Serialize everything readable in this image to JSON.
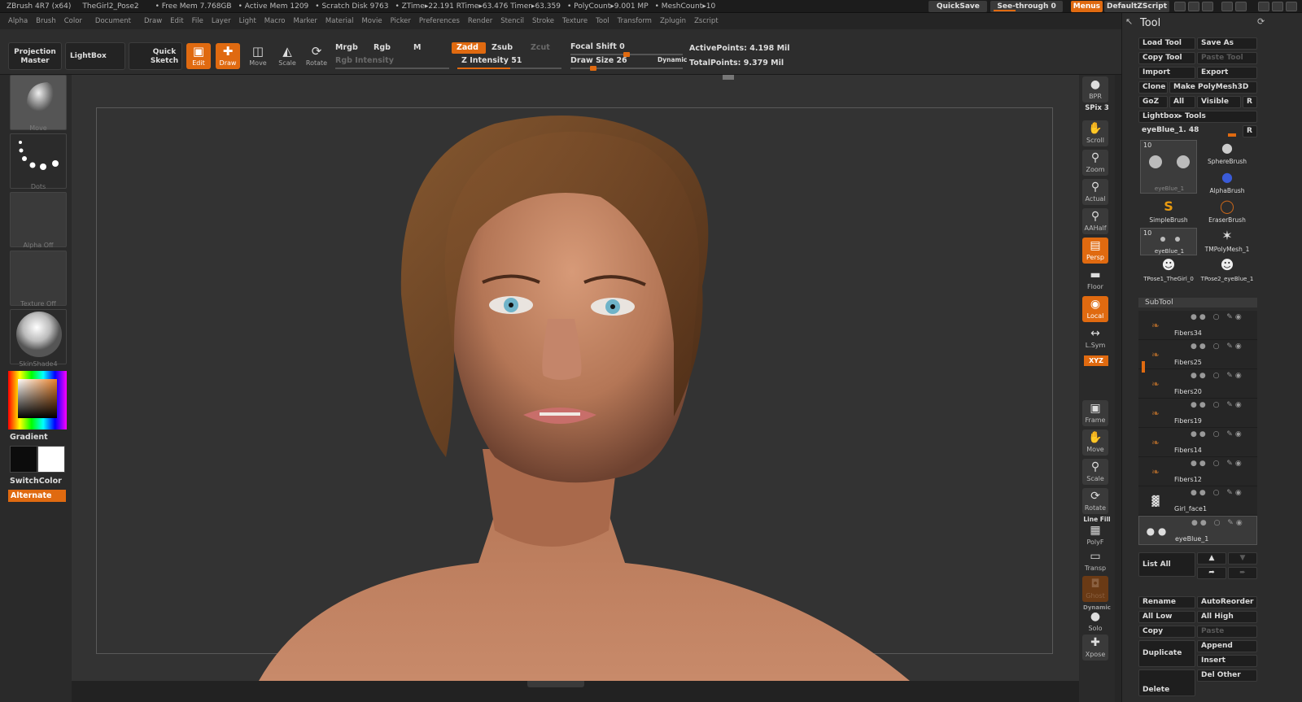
{
  "titlebar": {
    "app": "ZBrush 4R7 (x64)",
    "doc": "TheGirl2_Pose2",
    "free_mem": "• Free Mem 7.768GB",
    "active_mem": "• Active Mem 1209",
    "scratch": "• Scratch Disk 9763",
    "ztime": "• ZTime▸22.191 RTime▸63.476 Timer▸63.359",
    "polycount": "• PolyCount▸9.001 MP",
    "meshcount": "• MeshCount▸10",
    "quicksave": "QuickSave",
    "seethrough": "See-through  0",
    "menus": "Menus",
    "defaultzscript": "DefaultZScript"
  },
  "menubar": [
    "Alpha",
    "Brush",
    "Color",
    "Document",
    "Draw",
    "Edit",
    "File",
    "Layer",
    "Light",
    "Macro",
    "Marker",
    "Material",
    "Movie",
    "Picker",
    "Preferences",
    "Render",
    "Stencil",
    "Stroke",
    "Texture",
    "Tool",
    "Transform",
    "Zplugin",
    "Zscript"
  ],
  "toolbar": {
    "projection_master": "Projection Master",
    "lightbox": "LightBox",
    "quick_sketch": "Quick Sketch",
    "edit": "Edit",
    "draw": "Draw",
    "move": "Move",
    "scale": "Scale",
    "rotate": "Rotate",
    "mrgb": "Mrgb",
    "rgb": "Rgb",
    "m": "M",
    "rgb_intensity": "Rgb Intensity",
    "zadd": "Zadd",
    "zsub": "Zsub",
    "zcut": "Zcut",
    "z_intensity": "Z Intensity 51",
    "focal_shift": "Focal Shift 0",
    "draw_size": "Draw Size 26",
    "dynamic": "Dynamic",
    "active_points": "ActivePoints: 4.198  Mil",
    "total_points": "TotalPoints: 9.379  Mil",
    "z_intensity_level": 0.51,
    "focal_shift_level": 0.5,
    "draw_size_level": 0.2
  },
  "leftpanel": {
    "brush": "Move",
    "stroke": "Dots",
    "alpha": "Alpha  Off",
    "texture": "Texture  Off",
    "material": "SkinShade4",
    "gradient": "Gradient",
    "switchcolor": "SwitchColor",
    "alternate": "Alternate"
  },
  "rightshelf": {
    "bpr": "BPR",
    "spix": "SPix 3",
    "scroll": "Scroll",
    "zoom": "Zoom",
    "actual": "Actual",
    "aahalf": "AAHalf",
    "persp": "Persp",
    "floor": "Floor",
    "local": "Local",
    "lsym": "L.Sym",
    "xyz": "XYZ",
    "frame": "Frame",
    "move": "Move",
    "scale": "Scale",
    "rotate": "Rotate",
    "linefill": "Line Fill",
    "polyf": "PolyF",
    "transp": "Transp",
    "ghost": "Ghost",
    "dynamic": "Dynamic",
    "solo": "Solo",
    "xpose": "Xpose"
  },
  "toolpanel": {
    "title": "Tool",
    "load_tool": "Load Tool",
    "save_as": "Save As",
    "copy_tool": "Copy Tool",
    "paste_tool": "Paste Tool",
    "import": "Import",
    "export": "Export",
    "clone": "Clone",
    "make_polymesh": "Make PolyMesh3D",
    "goz": "GoZ",
    "all": "All",
    "visible": "Visible",
    "r": "R",
    "lightbox_tools": "Lightbox▸ Tools",
    "current_tool": "eyeBlue_1. 48",
    "current_tool_r": "R",
    "thumbs": [
      {
        "label": "eyeBlue_1",
        "count": "10"
      },
      {
        "label": "SphereBrush"
      },
      {
        "label": "AlphaBrush"
      },
      {
        "label": "SimpleBrush"
      },
      {
        "label": "EraserBrush"
      },
      {
        "label": "eyeBlue_1",
        "count": "10"
      },
      {
        "label": "TMPolyMesh_1"
      },
      {
        "label": "TPose1_TheGirl_0"
      },
      {
        "label": "TPose2_eyeBlue_1"
      }
    ],
    "subtool": "SubTool",
    "subtools": [
      "Fibers34",
      "Fibers25",
      "Fibers20",
      "Fibers19",
      "Fibers14",
      "Fibers12",
      "Girl_face1",
      "eyeBlue_1"
    ],
    "list_all": "List All",
    "rename": "Rename",
    "autoreorder": "AutoReorder",
    "all_low": "All Low",
    "all_high": "All High",
    "copy": "Copy",
    "paste": "Paste",
    "append": "Append",
    "duplicate": "Duplicate",
    "insert": "Insert",
    "delete": "Delete",
    "del_other": "Del Other"
  },
  "colors": {
    "accent": "#e06a10",
    "bg": "#262626",
    "viewport": "#333333"
  }
}
